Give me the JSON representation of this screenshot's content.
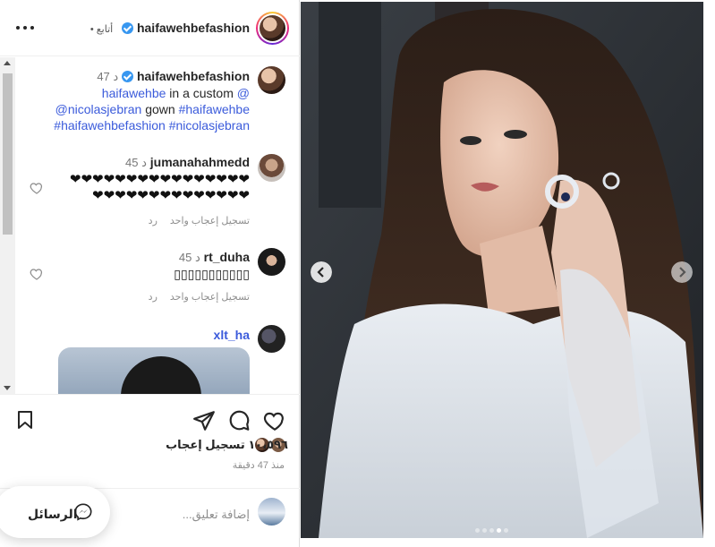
{
  "header": {
    "username": "haifawehbefashion",
    "follow_label": "• أتابع",
    "more_icon": "more-horizontal-icon"
  },
  "caption": {
    "username": "haifawehbefashion",
    "time": "47 د",
    "line1_mention": "haifawehbe",
    "line1_text": " in a custom ",
    "line1_at": "@",
    "line2_mention": "@nicolasjebran",
    "line2_text": " gown ",
    "line2_tag": "#haifawehbe",
    "line3": "#haifawehbefashion #nicolasjebran"
  },
  "comments": [
    {
      "username": "jumanahahmedd",
      "time": "45 د",
      "hearts_line1": "❤❤❤❤❤❤❤❤❤❤❤❤❤❤❤❤",
      "hearts_line2": "❤❤❤❤❤❤❤❤❤❤❤❤❤❤",
      "likes": "تسجيل إعجاب واحد",
      "reply": "رد"
    },
    {
      "username": "rt_duha",
      "time": "45 د",
      "text": "▯▯▯▯▯▯▯▯▯▯▯",
      "likes": "تسجيل إعجاب واحد",
      "reply": "رد"
    },
    {
      "username": "xlt_ha"
    }
  ],
  "likes_text": "١٠،٥٩٦ تسجيل إعجاب",
  "time_ago": "منذ 47 دقيقة",
  "add_comment_placeholder": "إضافة تعليق...",
  "messages_label": "الرسائل",
  "colors": {
    "link": "#3b5bdb",
    "verified": "#3897f0",
    "muted": "#8e8e8e"
  }
}
